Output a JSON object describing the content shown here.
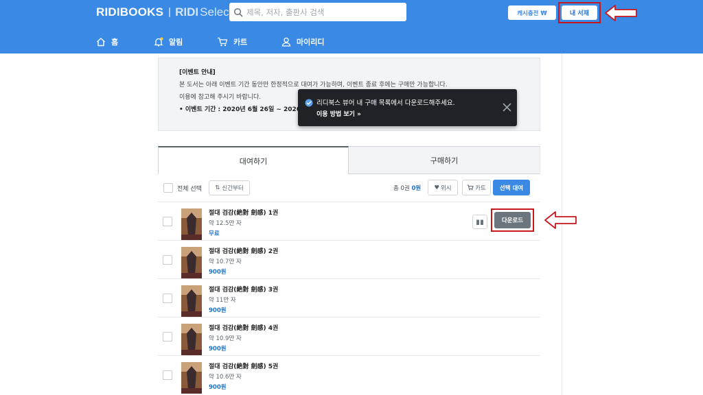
{
  "colors": {
    "brand": "#3a8ae5",
    "highlight_box": "#c8161d",
    "arrow": "#c8161d",
    "price": "#1f73d0"
  },
  "header": {
    "logo_main": "RIDIBOOKS",
    "logo_sub_bold": "RIDI",
    "logo_sub_light": "Select",
    "search_placeholder": "제목, 저자, 출판사 검색",
    "cash_button": "캐시충전 ₩",
    "library_button": "내 서재"
  },
  "nav": [
    {
      "label": "홈",
      "icon": "home-icon"
    },
    {
      "label": "알림",
      "icon": "bell-icon"
    },
    {
      "label": "카트",
      "icon": "cart-icon"
    },
    {
      "label": "마이리디",
      "icon": "user-icon"
    }
  ],
  "notice": {
    "heading": "[이벤트 안내]",
    "line1": "본 도서는 아래 이벤트 기간 동안만 한정적으로 대여가 가능하며, 이벤트 종료 후에는 구매만 가능합니다.",
    "line2": "이용에 참고해 주시기 바랍니다.",
    "period": "• 이벤트 기간 : 2020년 6월 26일 ~ 2020년"
  },
  "toast": {
    "message": "리디북스 뷰어 내 구매 목록에서 다운로드해주세요.",
    "link": "이용 방법 보기 »"
  },
  "tabs": {
    "rent": "대여하기",
    "buy": "구매하기"
  },
  "toolbar": {
    "select_all": "전체 선택",
    "sort": "신간부터",
    "total_prefix": "총 0권",
    "total_price": "0원",
    "wish": "위시",
    "cart": "카트",
    "rent_selected": "선택 대여"
  },
  "books": [
    {
      "title": "절대 검감(絶對 劍感) 1권",
      "chars": "약 12.5만 자",
      "price": "무료",
      "download": "다운로드"
    },
    {
      "title": "절대 검감(絶對 劍感) 2권",
      "chars": "약 10.7만 자",
      "price": "900원"
    },
    {
      "title": "절대 검감(絶對 劍感) 3권",
      "chars": "약 11만 자",
      "price": "900원"
    },
    {
      "title": "절대 검감(絶對 劍感) 4권",
      "chars": "약 10.9만 자",
      "price": "900원"
    },
    {
      "title": "절대 검감(絶對 劍感) 5권",
      "chars": "약 10.6만 자",
      "price": "900원"
    }
  ]
}
